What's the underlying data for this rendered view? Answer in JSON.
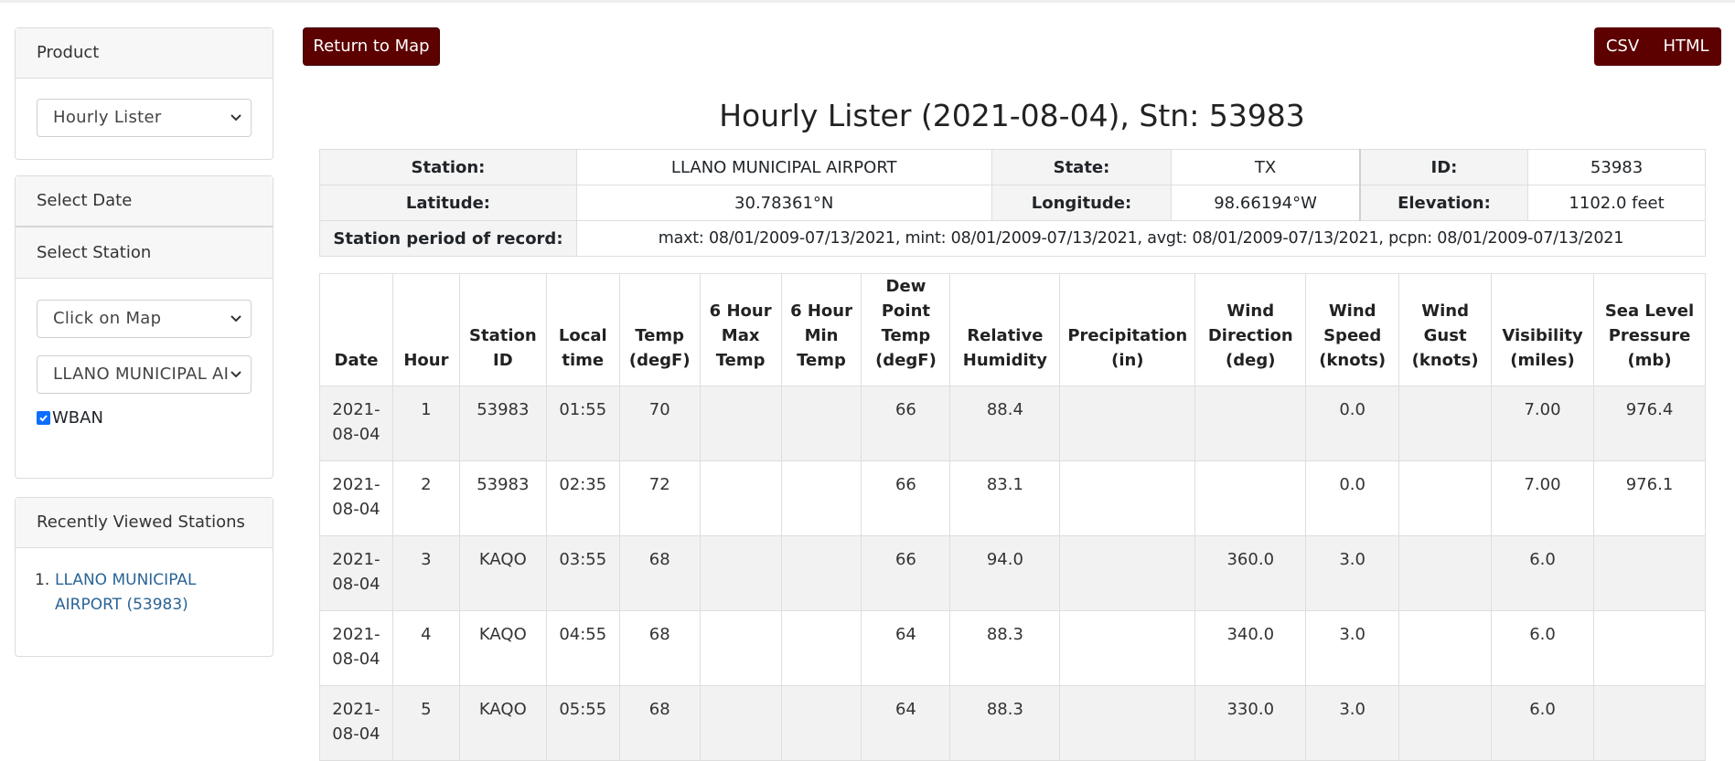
{
  "sidebar": {
    "product": {
      "header": "Product",
      "select_value": "Hourly Lister"
    },
    "select_date": {
      "header": "Select Date"
    },
    "select_station": {
      "header": "Select Station",
      "method_value": "Click on Map",
      "station_value": "LLANO MUNICIPAL AI",
      "wban_label": "WBAN",
      "wban_checked": true
    },
    "recent": {
      "header": "Recently Viewed Stations",
      "items": [
        {
          "number": "1.",
          "label": "LLANO MUNICIPAL AIRPORT (53983)"
        }
      ]
    }
  },
  "toolbar": {
    "return_label": "Return to Map",
    "csv_label": "CSV",
    "html_label": "HTML"
  },
  "title": "Hourly Lister (2021-08-04), Stn: 53983",
  "info": {
    "station_label": "Station:",
    "station_value": "LLANO MUNICIPAL AIRPORT",
    "state_label": "State:",
    "state_value": "TX",
    "id_label": "ID:",
    "id_value": "53983",
    "lat_label": "Latitude:",
    "lat_value": "30.78361°N",
    "lon_label": "Longitude:",
    "lon_value": "98.66194°W",
    "elev_label": "Elevation:",
    "elev_value": "1102.0 feet",
    "por_label": "Station period of record:",
    "por_value": "maxt: 08/01/2009-07/13/2021, mint: 08/01/2009-07/13/2021, avgt: 08/01/2009-07/13/2021, pcpn: 08/01/2009-07/13/2021"
  },
  "table": {
    "headers": [
      [
        "Date"
      ],
      [
        "Hour"
      ],
      [
        "Station",
        "ID"
      ],
      [
        "Local",
        "time"
      ],
      [
        "Temp",
        "(degF)"
      ],
      [
        "6 Hour",
        "Max",
        "Temp"
      ],
      [
        "6 Hour",
        "Min",
        "Temp"
      ],
      [
        "Dew",
        "Point",
        "Temp",
        "(degF)"
      ],
      [
        "Relative",
        "Humidity"
      ],
      [
        "Precipitation",
        "(in)"
      ],
      [
        "Wind",
        "Direction",
        "(deg)"
      ],
      [
        "Wind",
        "Speed",
        "(knots)"
      ],
      [
        "Wind",
        "Gust",
        "(knots)"
      ],
      [
        "Visibility",
        "(miles)"
      ],
      [
        "Sea Level",
        "Pressure",
        "(mb)"
      ]
    ],
    "rows": [
      [
        [
          "2021-",
          "08-04"
        ],
        "1",
        "53983",
        "01:55",
        "70",
        "",
        "",
        "66",
        "88.4",
        "",
        "",
        "0.0",
        "",
        "7.00",
        "976.4"
      ],
      [
        [
          "2021-",
          "08-04"
        ],
        "2",
        "53983",
        "02:35",
        "72",
        "",
        "",
        "66",
        "83.1",
        "",
        "",
        "0.0",
        "",
        "7.00",
        "976.1"
      ],
      [
        [
          "2021-",
          "08-04"
        ],
        "3",
        "KAQO",
        "03:55",
        "68",
        "",
        "",
        "66",
        "94.0",
        "",
        "360.0",
        "3.0",
        "",
        "6.0",
        ""
      ],
      [
        [
          "2021-",
          "08-04"
        ],
        "4",
        "KAQO",
        "04:55",
        "68",
        "",
        "",
        "64",
        "88.3",
        "",
        "340.0",
        "3.0",
        "",
        "6.0",
        ""
      ],
      [
        [
          "2021-",
          "08-04"
        ],
        "5",
        "KAQO",
        "05:55",
        "68",
        "",
        "",
        "64",
        "88.3",
        "",
        "330.0",
        "3.0",
        "",
        "6.0",
        ""
      ]
    ]
  },
  "icons": {
    "select": "chevron-down-icon",
    "checkbox": "checkmark-icon"
  },
  "colors": {
    "accent_dark_red": "#5c0000",
    "link": "#2a6496",
    "checkbox": "#0d6efd"
  }
}
